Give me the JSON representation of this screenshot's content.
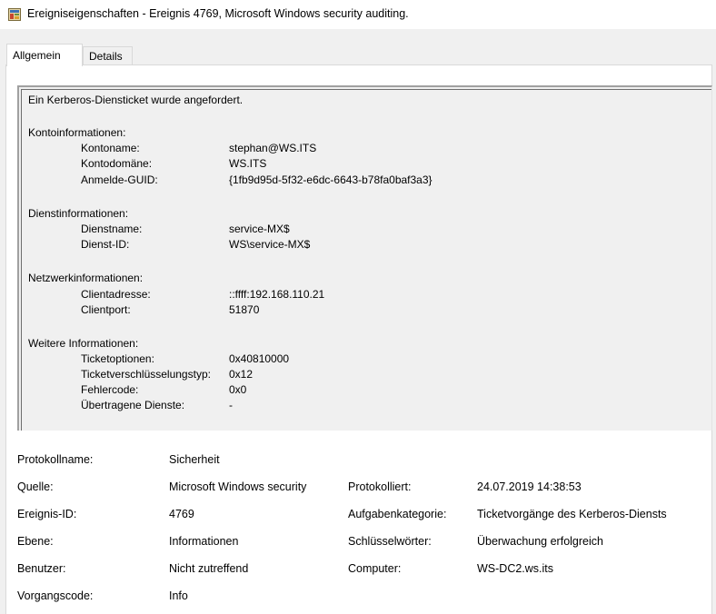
{
  "window": {
    "title": "Ereigniseigenschaften - Ereignis 4769, Microsoft Windows security auditing."
  },
  "tabs": [
    {
      "label": "Allgemein",
      "active": true
    },
    {
      "label": "Details",
      "active": false
    }
  ],
  "description": {
    "intro": "Ein Kerberos-Diensticket wurde angefordert.",
    "sections": [
      {
        "heading": "Kontoinformationen:",
        "fields": [
          {
            "key": "Kontoname:",
            "value": "stephan@WS.ITS"
          },
          {
            "key": "Kontodomäne:",
            "value": "WS.ITS"
          },
          {
            "key": "Anmelde-GUID:",
            "value": "{1fb9d95d-5f32-e6dc-6643-b78fa0baf3a3}"
          }
        ]
      },
      {
        "heading": "Dienstinformationen:",
        "fields": [
          {
            "key": "Dienstname:",
            "value": "service-MX$"
          },
          {
            "key": "Dienst-ID:",
            "value": "WS\\service-MX$"
          }
        ]
      },
      {
        "heading": "Netzwerkinformationen:",
        "fields": [
          {
            "key": "Clientadresse:",
            "value": "::ffff:192.168.110.21"
          },
          {
            "key": "Clientport:",
            "value": "51870"
          }
        ]
      },
      {
        "heading": "Weitere Informationen:",
        "fields": [
          {
            "key": "Ticketoptionen:",
            "value": "0x40810000"
          },
          {
            "key": "Ticketverschlüsselungstyp:",
            "value": "0x12"
          },
          {
            "key": "Fehlercode:",
            "value": "0x0"
          },
          {
            "key": "Übertragene Dienste:",
            "value": "-"
          }
        ]
      }
    ]
  },
  "properties": {
    "protokollname_label": "Protokollname:",
    "protokollname_value": "Sicherheit",
    "quelle_label": "Quelle:",
    "quelle_value": "Microsoft Windows security",
    "protokolliert_label": "Protokolliert:",
    "protokolliert_value": "24.07.2019 14:38:53",
    "ereignis_id_label": "Ereignis-ID:",
    "ereignis_id_value": "4769",
    "aufgabenkategorie_label": "Aufgabenkategorie:",
    "aufgabenkategorie_value": "Ticketvorgänge des Kerberos-Diensts",
    "ebene_label": "Ebene:",
    "ebene_value": "Informationen",
    "schluesselwoerter_label": "Schlüsselwörter:",
    "schluesselwoerter_value": "Überwachung erfolgreich",
    "benutzer_label": "Benutzer:",
    "benutzer_value": "Nicht zutreffend",
    "computer_label": "Computer:",
    "computer_value": "WS-DC2.ws.its",
    "vorgangscode_label": "Vorgangscode:",
    "vorgangscode_value": "Info"
  }
}
